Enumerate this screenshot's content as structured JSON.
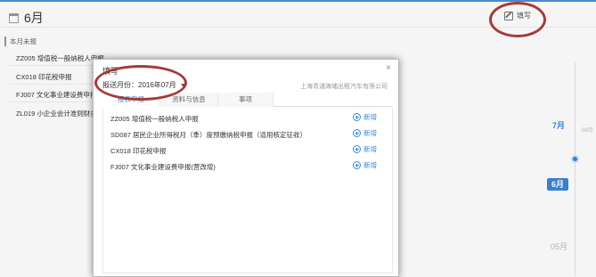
{
  "page": {
    "month_title": "6月",
    "edit_label": "填写",
    "section_label": "本月未报",
    "background_rows": [
      "ZZ005 增值税一般纳税人申报",
      "CX018 印花税申报",
      "FJ007 文化事业建设费申报(营",
      "ZL019 小企业会计准则财务报"
    ]
  },
  "timeline": {
    "july": "7月",
    "june": "6月",
    "may": "05月",
    "tiny_label": "08月"
  },
  "modal": {
    "title": "填写",
    "close": "×",
    "month_select": "报送月份：2016年07月",
    "company": "上海青浦海埔出租汽车有限公司",
    "tabs": [
      "报表申报",
      "资料与信息",
      "事项"
    ],
    "items": [
      {
        "name": "ZZ005 增值税一般纳税人申报",
        "action": "新增"
      },
      {
        "name": "SD087 居民企业所得税月（季）度预缴纳税申报（适用核定征收）",
        "action": "新增"
      },
      {
        "name": "CX018 印花税申报",
        "action": "新增"
      },
      {
        "name": "FJ007 文化事业建设费申报(营改增)",
        "action": "新增"
      }
    ]
  },
  "colors": {
    "accent": "#3b86d6",
    "annotation": "#a63a3a"
  }
}
